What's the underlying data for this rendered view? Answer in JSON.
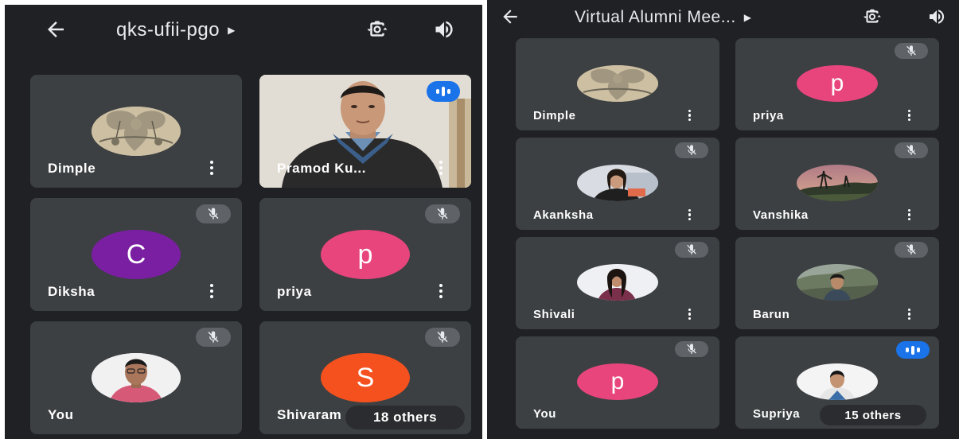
{
  "left": {
    "title": "qks-ufii-pgo",
    "others": "18 others",
    "tiles": [
      {
        "name": "Dimple"
      },
      {
        "name": "Pramod Ku..."
      },
      {
        "name": "Diksha",
        "initial": "C"
      },
      {
        "name": "priya",
        "initial": "p"
      },
      {
        "name": "You"
      },
      {
        "name": "Shivaram",
        "initial": "S"
      }
    ]
  },
  "right": {
    "title": "Virtual Alumni Mee...",
    "others": "15 others",
    "tiles": [
      {
        "name": "Dimple"
      },
      {
        "name": "priya",
        "initial": "p"
      },
      {
        "name": "Akanksha"
      },
      {
        "name": "Vanshika"
      },
      {
        "name": "Shivali"
      },
      {
        "name": "Barun"
      },
      {
        "name": "You",
        "initial": "p"
      },
      {
        "name": "Supriya"
      }
    ]
  },
  "colors": {
    "background": "#202124",
    "tile": "#3c4043",
    "purple": "#7b1fa2",
    "pink": "#e8457c",
    "orange": "#f4511e",
    "speaking": "#1a73e8",
    "muted_badge": "#5f6368"
  },
  "icons": [
    "back-arrow-icon",
    "caret-right-icon",
    "flip-camera-icon",
    "speaker-icon",
    "mic-off-icon",
    "more-vert-icon",
    "speaking-indicator-icon"
  ]
}
